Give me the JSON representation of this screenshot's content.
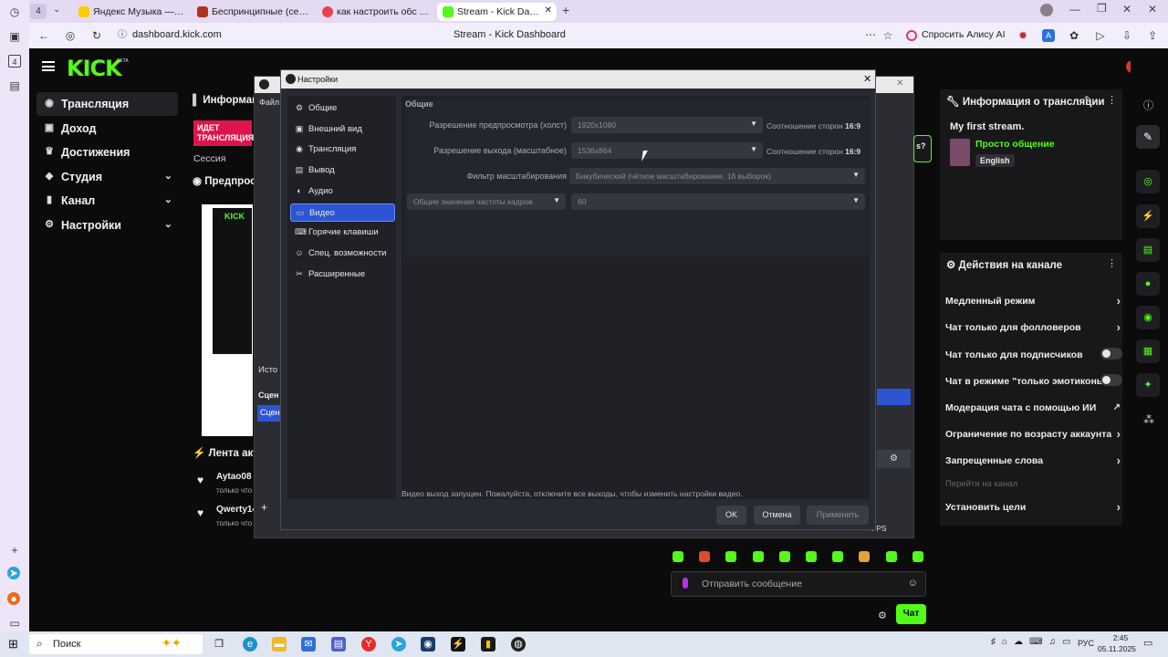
{
  "browser": {
    "tab_count": "4",
    "tabs": [
      {
        "title": "Яндекс Музыка — собир",
        "color": "#ffcc00"
      },
      {
        "title": "Беспринципные (сериал",
        "color": "#b3321f"
      },
      {
        "title": "как настроить обс для ст",
        "color": "#e8424f"
      },
      {
        "title": "Stream - Kick Dashboard",
        "color": "#53fc18"
      }
    ],
    "url": "dashboard.kick.com",
    "page_title": "Stream - Kick Dashboard",
    "alice_label": "Спросить Алису AI"
  },
  "kick": {
    "logo": "KICK",
    "beta": "BETA",
    "sidebar": [
      {
        "label": "Трансляция",
        "icon": "broadcast-icon",
        "chev": false
      },
      {
        "label": "Доход",
        "icon": "wallet-icon",
        "chev": false
      },
      {
        "label": "Достижения",
        "icon": "trophy-icon",
        "chev": false
      },
      {
        "label": "Студия",
        "icon": "studio-icon",
        "chev": true
      },
      {
        "label": "Канал",
        "icon": "channel-icon",
        "chev": true
      },
      {
        "label": "Настройки",
        "icon": "gear-icon",
        "chev": true
      }
    ],
    "info_cut": "Информац",
    "live_badge": "ИДЕТ ТРАНСЛЯЦИЯ",
    "session": "Сессия",
    "preview_cut": "Предпрос",
    "activity_cut": "Лента акти",
    "activity": [
      {
        "user": "Aytao08",
        "desc": "только что"
      },
      {
        "user": "Qwerty14",
        "desc": "только что"
      }
    ],
    "stream_info": {
      "header": "Информация о трансляции",
      "title": "My first stream.",
      "category": "Просто общение",
      "language": "English"
    },
    "channel_actions": {
      "header": "Действия на канале",
      "items": [
        {
          "label": "Медленный режим",
          "control": "arrow"
        },
        {
          "label": "Чат только для фолловеров",
          "control": "arrow"
        },
        {
          "label": "Чат только для подписчиков",
          "control": "toggle"
        },
        {
          "label": "Чат в режиме \"только эмотиконы\"",
          "control": "toggle"
        },
        {
          "label": "Модерация чата с помощью ИИ",
          "control": "external"
        },
        {
          "label": "Ограничение по возрасту аккаунта",
          "control": "arrow"
        },
        {
          "label": "Запрещенные слова",
          "control": "arrow"
        },
        {
          "label": "Перейти на канал",
          "control": "none"
        },
        {
          "label": "Установить цели",
          "control": "arrow"
        }
      ]
    },
    "chat": {
      "placeholder": "Отправить сообщение",
      "send_label": "Чат"
    }
  },
  "obs_background": {
    "menu_file": "Файл",
    "sources": "Исто",
    "scenes": "Сцен",
    "scene_item": "Сцен",
    "fps": "FPS",
    "question": "s?"
  },
  "settings": {
    "title": "Настройки",
    "nav": [
      {
        "label": "Общие",
        "icon": "gear-icon"
      },
      {
        "label": "Внешний вид",
        "icon": "appearance-icon"
      },
      {
        "label": "Трансляция",
        "icon": "broadcast-icon"
      },
      {
        "label": "Вывод",
        "icon": "output-icon"
      },
      {
        "label": "Аудио",
        "icon": "audio-icon"
      },
      {
        "label": "Видео",
        "icon": "monitor-icon"
      },
      {
        "label": "Горячие клавиши",
        "icon": "keyboard-icon"
      },
      {
        "label": "Спец. возможности",
        "icon": "accessibility-icon"
      },
      {
        "label": "Расширенные",
        "icon": "wrench-icon"
      }
    ],
    "active_index": 5,
    "section": "Общие",
    "base_res_label": "Разрешение предпросмотра (холст)",
    "base_res_value": "1920x1080",
    "out_res_label": "Разрешение выхода (масштабное)",
    "out_res_value": "1536x864",
    "aspect_label": "Соотношение сторон",
    "aspect_value": "16:9",
    "filter_label": "Фильтр масштабирования",
    "filter_value": "Бикубический (чёткое масштабирование, 16 выборок)",
    "fps_type": "Общие значения частоты кадров",
    "fps_value": "60",
    "warning": "Видео выход запущен. Пожалуйста, отключите все выходы, чтобы изменить настройки видео.",
    "ok": "OK",
    "cancel": "Отмена",
    "apply": "Применить"
  },
  "taskbar": {
    "search": "Поиск",
    "lang": "РУС",
    "time": "2:45",
    "date": "05.11.2025"
  },
  "colors": {
    "kick_green": "#53fc18",
    "obs_active": "#2d55d3",
    "live_red": "#e0144c"
  }
}
